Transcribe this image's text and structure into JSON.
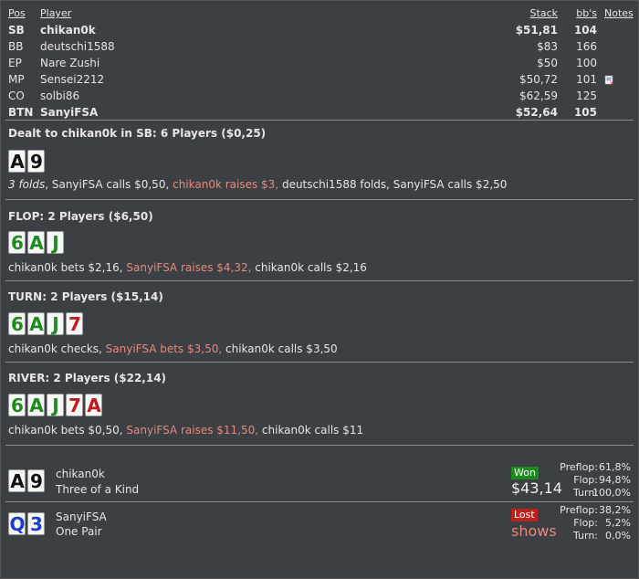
{
  "players_table": {
    "headers": {
      "pos": "Pos",
      "player": "Player",
      "stack": "Stack",
      "bbs": "bb's",
      "notes": "Notes"
    },
    "rows": [
      {
        "pos": "SB",
        "player": "chikan0k",
        "stack": "$51,81",
        "bbs": "104",
        "bold": true,
        "note": false
      },
      {
        "pos": "BB",
        "player": "deutschi1588",
        "stack": "$83",
        "bbs": "166",
        "bold": false,
        "note": false
      },
      {
        "pos": "EP",
        "player": "Nare Zushi",
        "stack": "$50",
        "bbs": "100",
        "bold": false,
        "note": false
      },
      {
        "pos": "MP",
        "player": "Sensei2212",
        "stack": "$50,72",
        "bbs": "101",
        "bold": false,
        "note": true
      },
      {
        "pos": "CO",
        "player": "solbi86",
        "stack": "$62,59",
        "bbs": "125",
        "bold": false,
        "note": false
      },
      {
        "pos": "BTN",
        "player": "SanyiFSA",
        "stack": "$52,64",
        "bbs": "105",
        "bold": true,
        "note": false
      }
    ]
  },
  "preflop": {
    "title": "Dealt to chikan0k in SB: 6 Players ($0,25)",
    "cards": [
      {
        "rank": "A",
        "suit": "s"
      },
      {
        "rank": "9",
        "suit": "s"
      }
    ],
    "actions": [
      {
        "text": "3 folds",
        "type": "folds"
      },
      {
        "text": ", SanyiFSA calls $0,50, ",
        "type": "normal"
      },
      {
        "text": "chikan0k raises $3,",
        "type": "raise"
      },
      {
        "text": " deutschi1588 folds, SanyiFSA calls $2,50",
        "type": "normal"
      }
    ]
  },
  "flop": {
    "title": "FLOP: 2 Players ($6,50)",
    "cards": [
      {
        "rank": "6",
        "suit": "c"
      },
      {
        "rank": "A",
        "suit": "c"
      },
      {
        "rank": "J",
        "suit": "c"
      }
    ],
    "actions": [
      {
        "text": "chikan0k bets $2,16, ",
        "type": "normal"
      },
      {
        "text": "SanyiFSA raises $4,32,",
        "type": "raise"
      },
      {
        "text": " chikan0k calls $2,16",
        "type": "normal"
      }
    ]
  },
  "turn": {
    "title": "TURN: 2 Players ($15,14)",
    "cards": [
      {
        "rank": "6",
        "suit": "c"
      },
      {
        "rank": "A",
        "suit": "c"
      },
      {
        "rank": "J",
        "suit": "c"
      },
      {
        "rank": "7",
        "suit": "h"
      }
    ],
    "actions": [
      {
        "text": "chikan0k checks, ",
        "type": "normal"
      },
      {
        "text": "SanyiFSA bets $3,50,",
        "type": "raise"
      },
      {
        "text": " chikan0k calls $3,50",
        "type": "normal"
      }
    ]
  },
  "river": {
    "title": "RIVER: 2 Players ($22,14)",
    "cards": [
      {
        "rank": "6",
        "suit": "c"
      },
      {
        "rank": "A",
        "suit": "c"
      },
      {
        "rank": "J",
        "suit": "c"
      },
      {
        "rank": "7",
        "suit": "h"
      },
      {
        "rank": "A",
        "suit": "h"
      }
    ],
    "actions": [
      {
        "text": "chikan0k bets $0,50, ",
        "type": "normal"
      },
      {
        "text": "SanyiFSA raises $11,50,",
        "type": "raise"
      },
      {
        "text": " chikan0k calls $11",
        "type": "normal"
      }
    ]
  },
  "showdown": [
    {
      "cards": [
        {
          "rank": "A",
          "suit": "s"
        },
        {
          "rank": "9",
          "suit": "s"
        }
      ],
      "name": "chikan0k",
      "hand": "Three of a Kind",
      "badge": "Won",
      "result": "$43,14",
      "equity": [
        {
          "label": "Preflop:",
          "value": "61,8%"
        },
        {
          "label": "Flop:",
          "value": "94,8%"
        },
        {
          "label": "Turn:",
          "value": "100,0%"
        }
      ]
    },
    {
      "cards": [
        {
          "rank": "Q",
          "suit": "d"
        },
        {
          "rank": "3",
          "suit": "d"
        }
      ],
      "name": "SanyiFSA",
      "hand": "One Pair",
      "badge": "Lost",
      "result": "shows",
      "equity": [
        {
          "label": "Preflop:",
          "value": "38,2%"
        },
        {
          "label": "Flop:",
          "value": "5,2%"
        },
        {
          "label": "Turn:",
          "value": "0,0%"
        }
      ]
    }
  ],
  "colors": {
    "raise": "#e8897a",
    "won": "#1e8a1e",
    "lost": "#c0201c",
    "clubs": "#1f8a1f",
    "hearts": "#c11a1a",
    "diamonds": "#1c3fc4",
    "spades": "#111111"
  }
}
